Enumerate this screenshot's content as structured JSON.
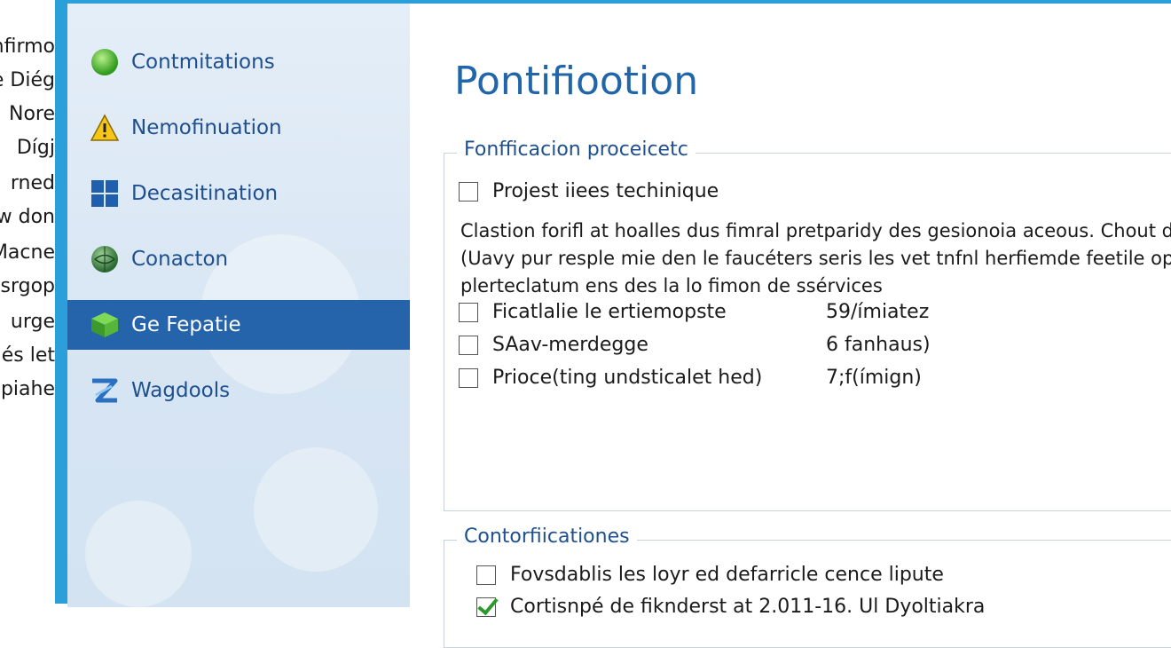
{
  "background_list": [
    "nfirmo",
    "e Diég",
    "Nore",
    "Dígj",
    "rned",
    "w don",
    "Macne",
    "esrgop",
    "urge",
    "és let",
    "spiahe"
  ],
  "sidebar": {
    "items": [
      {
        "label": "Contmitations",
        "icon": "green-orb-icon",
        "selected": false
      },
      {
        "label": "Nemofinuation",
        "icon": "warning-icon",
        "selected": false
      },
      {
        "label": "Decasitination",
        "icon": "grid-icon",
        "selected": false
      },
      {
        "label": "Conacton",
        "icon": "network-orb-icon",
        "selected": false
      },
      {
        "label": "Ge Fepatie",
        "icon": "green-cube-icon",
        "selected": true
      },
      {
        "label": "Wagdools",
        "icon": "tools-icon",
        "selected": false
      }
    ]
  },
  "main": {
    "title": "Pontifiootion",
    "group1": {
      "title": "Fonfficacion proceicetc",
      "first_checkbox": {
        "label": "Projest iiees techinique",
        "checked": false
      },
      "paragraph": [
        "Clastion forifl at hoalles dus fimral pretparidy des gesionoia aceous. Chout de",
        "(Uavy pur resple mie den le faucéters seris les vet tnfnl herfiemde feetile op",
        "plerteclatum ens des la lo fimon de ssérvices"
      ],
      "rows": [
        {
          "label": "Ficatlalie le ertiemopste",
          "value": "59/ímiatez",
          "checked": false
        },
        {
          "label": "SAav-merdegge",
          "value": "6 fanhaus)",
          "checked": false
        },
        {
          "label": "Prioce(ting undsticalet hed)",
          "value": "7;f(ímign)",
          "checked": false
        }
      ]
    },
    "group2": {
      "title": "Contorfiicationes",
      "rows": [
        {
          "label": "Fovsdablis les loyr ed defarricle cence lipute",
          "checked": false
        },
        {
          "label": "Cortisnpé de fiknderst at 2.011-16. Ul Dyoltiakra",
          "checked": true
        }
      ]
    }
  }
}
